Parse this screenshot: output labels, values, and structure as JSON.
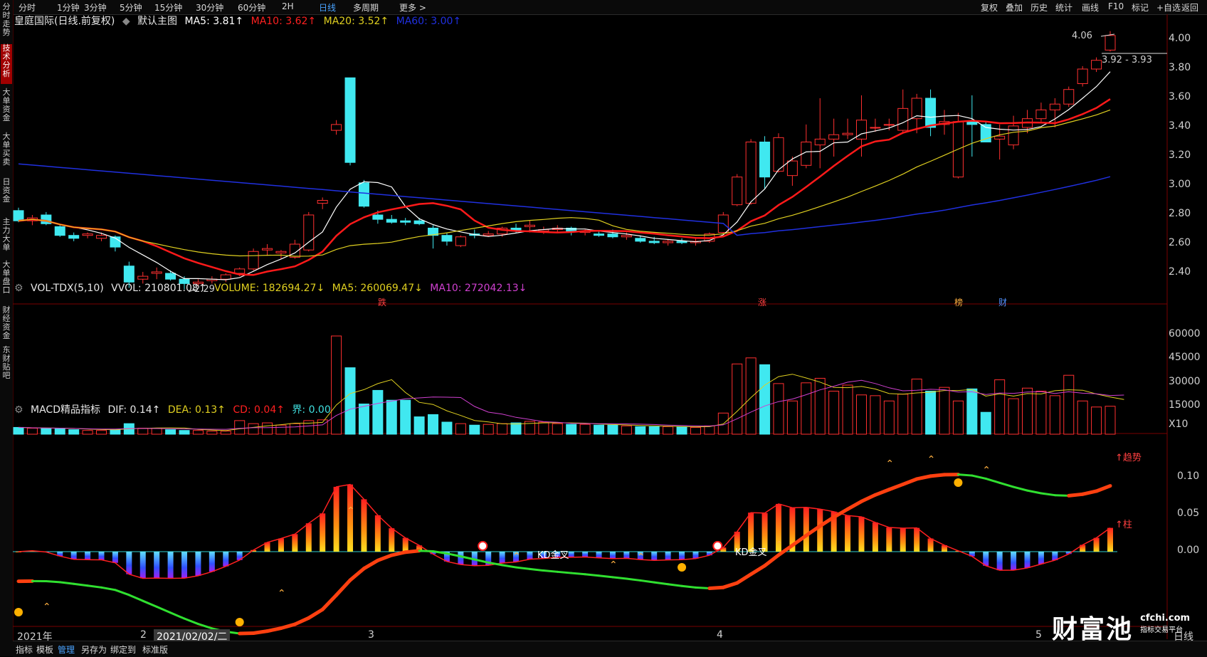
{
  "toolbar": {
    "periods": [
      "分时",
      "1分钟",
      "3分钟",
      "5分钟",
      "15分钟",
      "30分钟",
      "60分钟",
      "2H",
      "日线",
      "多周期",
      "更多 >"
    ],
    "selected": "日线",
    "right_buttons": [
      "复权",
      "叠加",
      "历史",
      "统计",
      "画线",
      "F10",
      "标记",
      "+自选",
      "返回"
    ]
  },
  "sidebar": {
    "tabs": [
      "分时走势",
      "技术分析",
      "大单资金",
      "大单买卖",
      "日资金",
      "主力大单",
      "大单盘口",
      "财经资金",
      "东财贴吧"
    ],
    "selected": "技术分析"
  },
  "main_legend": {
    "title": "皇庭国际(日线.前复权)",
    "template": "默认主图",
    "ma5": "MA5: 3.81↑",
    "ma10": "MA10: 3.62↑",
    "ma20": "MA20: 3.52↑",
    "ma60": "MA60: 3.00↑",
    "colors": {
      "ma5": "#ffffff",
      "ma10": "#ff2020",
      "ma20": "#e0d020",
      "ma60": "#2030e0"
    }
  },
  "vol_legend": {
    "name": "VOL-TDX(5,10)",
    "vvol": "VVOL: 210801.08↑",
    "volume": "VOLUME: 182694.27↓",
    "ma5": "MA5: 260069.47↓",
    "ma10": "MA10: 272042.13↓"
  },
  "macd_legend": {
    "name": "MACD精品指标",
    "dif": "DIF: 0.14↑",
    "dea": "DEA: 0.13↑",
    "cd": "CD: 0.04↑",
    "jie": "界: 0.00"
  },
  "price_axis": [
    "4.00",
    "3.80",
    "3.60",
    "3.40",
    "3.20",
    "3.00",
    "2.80",
    "2.60",
    "2.40"
  ],
  "vol_axis": [
    "60000",
    "45000",
    "30000",
    "15000",
    "X10"
  ],
  "macd_axis": [
    "0.10",
    "0.05",
    "0.00"
  ],
  "time_axis": [
    "2021年",
    "2",
    "2021/02/02/二",
    "3",
    "4",
    "5",
    "日线"
  ],
  "annotations": {
    "high_value": "4.06",
    "range": "3.92 - 3.93",
    "low_value": "2.29",
    "marks": [
      "跌",
      "涨",
      "榜",
      "财"
    ],
    "kd1": "KD金叉",
    "kd2": "KD金叉",
    "trend": "↑趋势",
    "zhu": "↑柱"
  },
  "bottom_tabs": [
    "指标",
    "模板",
    "管理",
    "另存为",
    "绑定到",
    "标准版"
  ],
  "bottom_selected": "管理",
  "logo": {
    "main": "财富池",
    "site": "cfchi.com",
    "sub": "指标交易平台"
  },
  "chart_data": {
    "type": "bar",
    "candles_ohlc": [
      [
        2.83,
        2.85,
        2.75,
        2.76
      ],
      [
        2.76,
        2.8,
        2.73,
        2.78
      ],
      [
        2.8,
        2.82,
        2.73,
        2.74
      ],
      [
        2.72,
        2.73,
        2.65,
        2.66
      ],
      [
        2.66,
        2.68,
        2.62,
        2.64
      ],
      [
        2.66,
        2.68,
        2.64,
        2.67
      ],
      [
        2.64,
        2.68,
        2.62,
        2.66
      ],
      [
        2.65,
        2.66,
        2.55,
        2.58
      ],
      [
        2.45,
        2.48,
        2.3,
        2.34
      ],
      [
        2.36,
        2.41,
        2.33,
        2.38
      ],
      [
        2.4,
        2.44,
        2.36,
        2.41
      ],
      [
        2.4,
        2.42,
        2.35,
        2.36
      ],
      [
        2.36,
        2.38,
        2.29,
        2.33
      ],
      [
        2.33,
        2.36,
        2.31,
        2.34
      ],
      [
        2.35,
        2.38,
        2.33,
        2.36
      ],
      [
        2.36,
        2.4,
        2.34,
        2.39
      ],
      [
        2.4,
        2.44,
        2.38,
        2.43
      ],
      [
        2.43,
        2.57,
        2.42,
        2.55
      ],
      [
        2.56,
        2.6,
        2.52,
        2.57
      ],
      [
        2.54,
        2.56,
        2.5,
        2.55
      ],
      [
        2.51,
        2.63,
        2.5,
        2.6
      ],
      [
        2.56,
        2.82,
        2.55,
        2.8
      ],
      [
        2.88,
        2.92,
        2.84,
        2.9
      ],
      [
        3.38,
        3.45,
        3.35,
        3.42
      ],
      [
        3.74,
        3.74,
        3.14,
        3.16
      ],
      [
        3.02,
        3.04,
        2.85,
        2.86
      ],
      [
        2.8,
        2.83,
        2.74,
        2.77
      ],
      [
        2.77,
        2.8,
        2.74,
        2.75
      ],
      [
        2.76,
        2.78,
        2.73,
        2.75
      ],
      [
        2.76,
        2.78,
        2.73,
        2.74
      ],
      [
        2.71,
        2.73,
        2.57,
        2.66
      ],
      [
        2.66,
        2.68,
        2.59,
        2.62
      ],
      [
        2.59,
        2.66,
        2.58,
        2.65
      ],
      [
        2.67,
        2.7,
        2.64,
        2.66
      ],
      [
        2.66,
        2.69,
        2.65,
        2.67
      ],
      [
        2.67,
        2.72,
        2.65,
        2.71
      ],
      [
        2.71,
        2.74,
        2.68,
        2.69
      ],
      [
        2.72,
        2.76,
        2.68,
        2.73
      ],
      [
        2.69,
        2.72,
        2.67,
        2.7
      ],
      [
        2.7,
        2.73,
        2.68,
        2.71
      ],
      [
        2.71,
        2.72,
        2.66,
        2.69
      ],
      [
        2.68,
        2.7,
        2.66,
        2.69
      ],
      [
        2.67,
        2.69,
        2.65,
        2.66
      ],
      [
        2.67,
        2.7,
        2.64,
        2.65
      ],
      [
        2.65,
        2.68,
        2.63,
        2.66
      ],
      [
        2.64,
        2.66,
        2.61,
        2.62
      ],
      [
        2.62,
        2.65,
        2.6,
        2.61
      ],
      [
        2.61,
        2.63,
        2.59,
        2.62
      ],
      [
        2.62,
        2.64,
        2.6,
        2.61
      ],
      [
        2.61,
        2.64,
        2.59,
        2.62
      ],
      [
        2.62,
        2.68,
        2.61,
        2.67
      ],
      [
        2.68,
        2.82,
        2.67,
        2.8
      ],
      [
        2.87,
        3.08,
        2.86,
        3.06
      ],
      [
        2.88,
        3.32,
        2.87,
        3.3
      ],
      [
        3.3,
        3.34,
        2.98,
        3.06
      ],
      [
        3.1,
        3.36,
        3.09,
        3.33
      ],
      [
        3.07,
        3.2,
        3.0,
        3.17
      ],
      [
        3.14,
        3.42,
        3.12,
        3.3
      ],
      [
        3.28,
        3.6,
        3.12,
        3.32
      ],
      [
        3.32,
        3.46,
        3.2,
        3.35
      ],
      [
        3.35,
        3.46,
        3.32,
        3.36
      ],
      [
        3.32,
        3.62,
        3.2,
        3.45
      ],
      [
        3.4,
        3.46,
        3.37,
        3.4
      ],
      [
        3.42,
        3.46,
        3.38,
        3.42
      ],
      [
        3.38,
        3.66,
        3.36,
        3.53
      ],
      [
        3.46,
        3.63,
        3.36,
        3.6
      ],
      [
        3.6,
        3.66,
        3.34,
        3.4
      ],
      [
        3.42,
        3.52,
        3.35,
        3.44
      ],
      [
        3.06,
        3.5,
        3.05,
        3.44
      ],
      [
        3.44,
        3.62,
        3.2,
        3.42
      ],
      [
        3.42,
        3.44,
        3.3,
        3.3
      ],
      [
        3.32,
        3.42,
        3.18,
        3.34
      ],
      [
        3.28,
        3.48,
        3.25,
        3.41
      ],
      [
        3.4,
        3.52,
        3.36,
        3.46
      ],
      [
        3.46,
        3.57,
        3.44,
        3.52
      ],
      [
        3.52,
        3.6,
        3.4,
        3.56
      ],
      [
        3.56,
        3.68,
        3.54,
        3.66
      ],
      [
        3.7,
        3.82,
        3.68,
        3.8
      ],
      [
        3.8,
        3.88,
        3.78,
        3.86
      ],
      [
        3.93,
        4.06,
        3.92,
        4.03
      ]
    ],
    "volume_x10": [
      9000,
      8000,
      8000,
      7000,
      6000,
      5000,
      5000,
      6000,
      14000,
      8000,
      8000,
      6000,
      5000,
      5000,
      4000,
      4000,
      18000,
      14000,
      15000,
      12000,
      14000,
      18000,
      19000,
      130000,
      88000,
      40000,
      58000,
      45000,
      45000,
      23000,
      26000,
      16000,
      14000,
      12000,
      13000,
      14000,
      15000,
      17000,
      16000,
      14000,
      13000,
      13000,
      12000,
      12000,
      11000,
      10000,
      10000,
      10000,
      10000,
      9000,
      11000,
      28000,
      93000,
      101000,
      92000,
      67000,
      44000,
      68000,
      74000,
      57000,
      65000,
      52000,
      51000,
      44000,
      53000,
      73000,
      57000,
      62000,
      44000,
      60000,
      29000,
      72000,
      47000,
      61000,
      57000,
      51000,
      78000,
      44000,
      36000,
      37000,
      35000
    ],
    "y_range_price": [
      2.3,
      4.06
    ],
    "series": [
      {
        "name": "MA5",
        "color": "#ffffff"
      },
      {
        "name": "MA10",
        "color": "#ff2020"
      },
      {
        "name": "MA20",
        "color": "#e0d020"
      },
      {
        "name": "MA60",
        "color": "#2030e0"
      }
    ]
  }
}
